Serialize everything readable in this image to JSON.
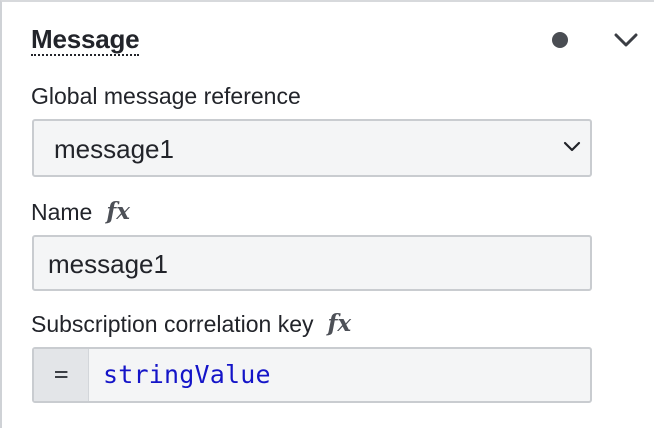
{
  "section": {
    "title": "Message",
    "accent_dot_color": "#4a4d53"
  },
  "global_message_reference": {
    "label": "Global message reference",
    "selected": "message1"
  },
  "name": {
    "label": "Name",
    "fx": "fx",
    "value": "message1"
  },
  "subscription_correlation_key": {
    "label": "Subscription correlation key",
    "fx": "fx",
    "prefix": "=",
    "value": "stringValue"
  },
  "icons": {
    "collapse": "chevron-down-icon",
    "select_arrow": "chevron-down-icon",
    "status_dot": "status-dot-icon"
  }
}
